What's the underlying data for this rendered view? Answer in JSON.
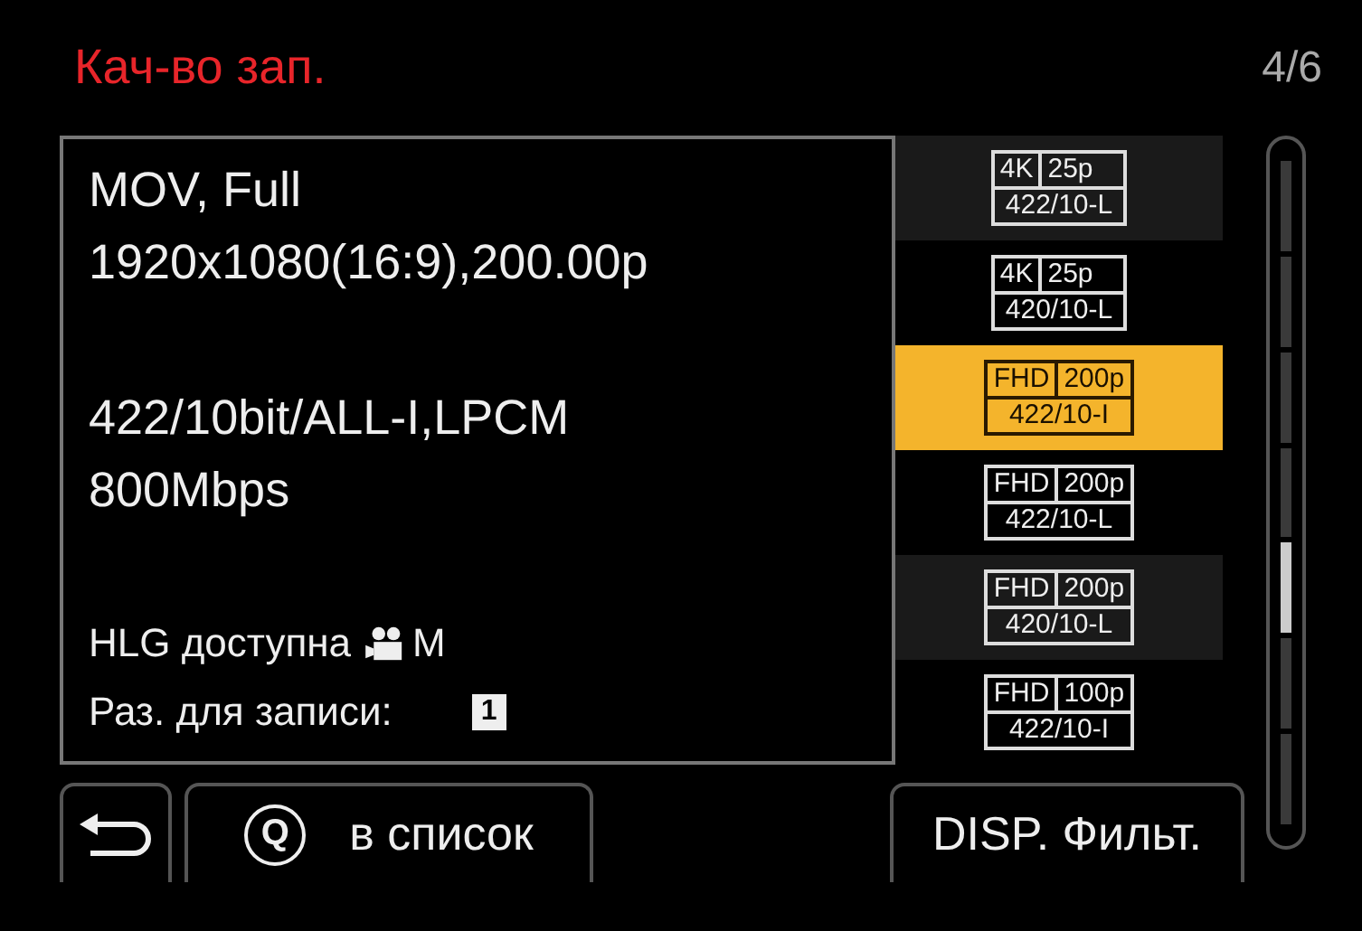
{
  "header": {
    "title": "Кач-во зап.",
    "page": "4/6"
  },
  "info": {
    "groups": [
      [
        "MOV, Full",
        "1920x1080(16:9),200.00p"
      ],
      [
        "422/10bit/ALL-I,LPCM",
        "800Mbps"
      ]
    ],
    "hlg": {
      "label": "HLG доступна",
      "mode_letter": "M"
    },
    "card": {
      "label": "Раз. для записи:",
      "slot": "1"
    }
  },
  "items": [
    {
      "resolution": "4K",
      "fps": "25p",
      "format": "422/10-L",
      "selected": false
    },
    {
      "resolution": "4K",
      "fps": "25p",
      "format": "420/10-L",
      "selected": false
    },
    {
      "resolution": "FHD",
      "fps": "200p",
      "format": "422/10-I",
      "selected": true
    },
    {
      "resolution": "FHD",
      "fps": "200p",
      "format": "422/10-L",
      "selected": false
    },
    {
      "resolution": "FHD",
      "fps": "200p",
      "format": "420/10-L",
      "selected": false
    },
    {
      "resolution": "FHD",
      "fps": "100p",
      "format": "422/10-I",
      "selected": false
    }
  ],
  "buttons": {
    "list": {
      "key": "Q",
      "label": "в список"
    },
    "filter": {
      "label": "DISP. Фильт."
    }
  }
}
